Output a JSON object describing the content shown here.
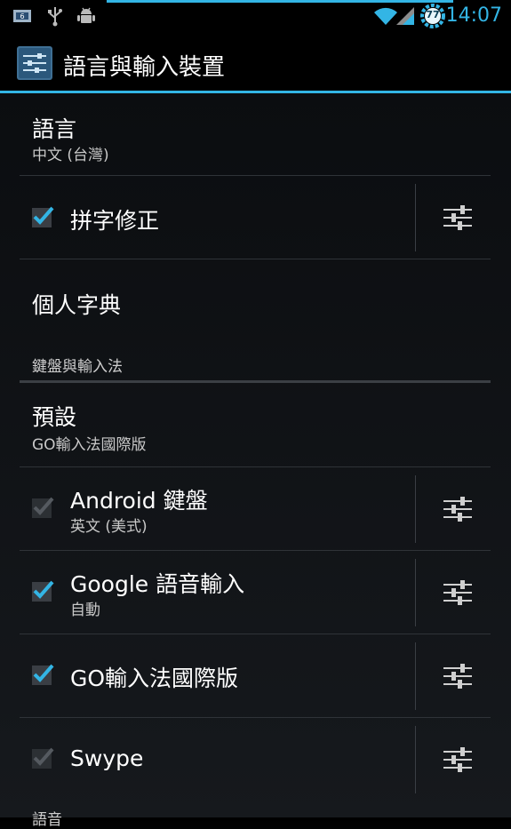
{
  "status_bar": {
    "time": "14:07",
    "battery_level": "77",
    "icons": [
      "gallery-notification-icon",
      "usb-icon",
      "android-debug-icon",
      "wifi-icon",
      "signal-icon",
      "battery-icon"
    ]
  },
  "action_bar": {
    "title": "語言與輸入裝置",
    "icon": "settings-sliders-icon"
  },
  "list": {
    "language": {
      "title": "語言",
      "summary": "中文 (台灣)"
    },
    "spell_check": {
      "title": "拼字修正",
      "checked": true
    },
    "dictionary": {
      "title": "個人字典"
    },
    "section_keyboard": "鍵盤與輸入法",
    "default": {
      "title": "預設",
      "summary": "GO輸入法國際版"
    },
    "android_keyboard": {
      "title": "Android 鍵盤",
      "summary": "英文 (美式)",
      "checked": true,
      "enabled": false
    },
    "google_voice": {
      "title": "Google 語音輸入",
      "summary": "自動",
      "checked": true,
      "enabled": true
    },
    "go_keyboard": {
      "title": "GO輸入法國際版",
      "checked": true,
      "enabled": true
    },
    "swype": {
      "title": "Swype",
      "checked": true,
      "enabled": false
    },
    "section_voice": "語音"
  },
  "colors": {
    "accent": "#33b5e5",
    "background": "#101215"
  }
}
